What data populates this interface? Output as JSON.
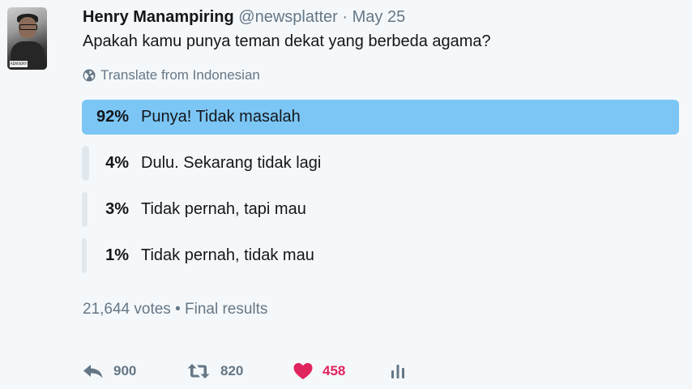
{
  "tweet": {
    "author_name": "Henry Manampiring",
    "handle": "@newsplatter",
    "separator": "·",
    "date": "May 25",
    "text": "Apakah kamu punya teman dekat yang berbeda agama?",
    "translate_label": "Translate from Indonesian"
  },
  "avatar": {
    "tag_text": "ADVISORY"
  },
  "poll": {
    "choices": [
      {
        "percent_label": "92%",
        "label": "Punya! Tidak masalah",
        "percent": 92,
        "winner": true
      },
      {
        "percent_label": "4%",
        "label": "Dulu. Sekarang tidak lagi",
        "percent": 4,
        "winner": false
      },
      {
        "percent_label": "3%",
        "label": "Tidak pernah, tapi mau",
        "percent": 3,
        "winner": false
      },
      {
        "percent_label": "1%",
        "label": "Tidak pernah, tidak mau",
        "percent": 1,
        "winner": false
      }
    ],
    "results_text": "21,644 votes • Final results"
  },
  "actions": {
    "reply_count": "900",
    "retweet_count": "820",
    "like_count": "458"
  },
  "colors": {
    "winner_bar": "#7cc6f6",
    "other_bar": "#e1e8ed",
    "like": "#e0245e",
    "muted": "#657786"
  },
  "icons": [
    "globe-icon",
    "reply-icon",
    "retweet-icon",
    "heart-icon",
    "analytics-icon"
  ]
}
